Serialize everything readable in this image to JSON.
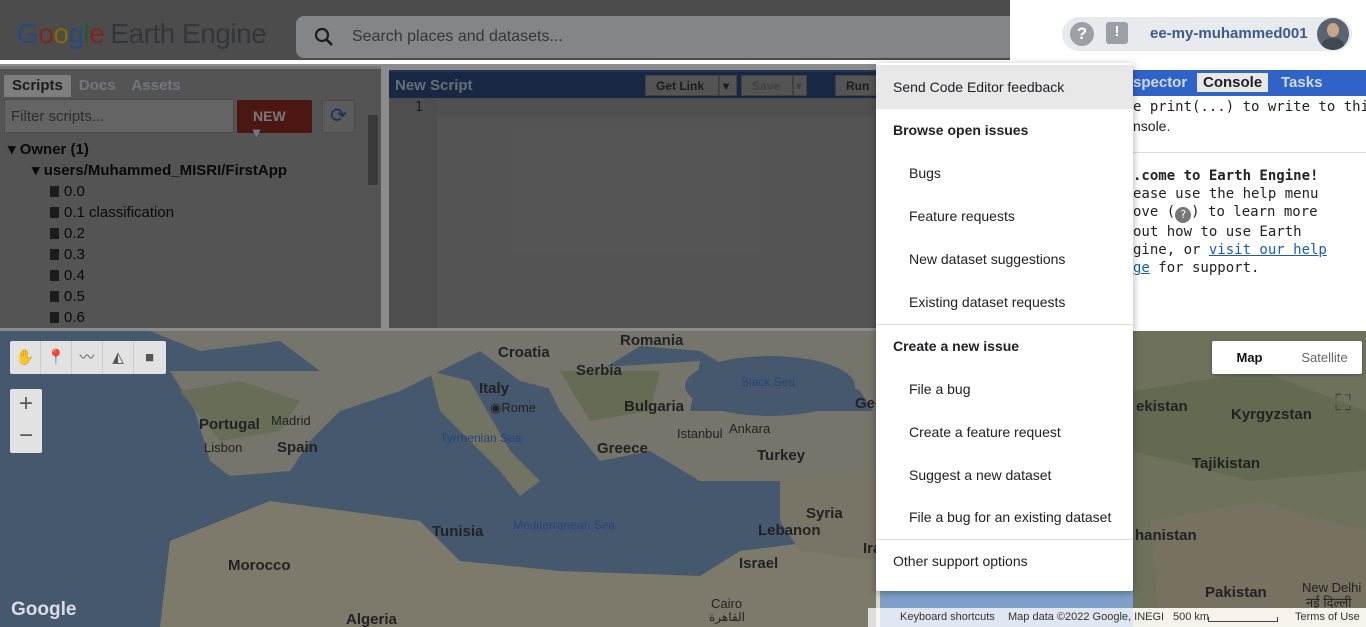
{
  "header": {
    "logo_google": "Google",
    "logo_product": "Earth Engine",
    "search_placeholder": "Search places and datasets...",
    "username": "ee-my-muhammed001",
    "help_glyph": "?",
    "feedback_glyph": "!"
  },
  "left_panel": {
    "tabs": [
      "Scripts",
      "Docs",
      "Assets"
    ],
    "filter_placeholder": "Filter scripts...",
    "new_button": "NEW",
    "tree": {
      "owner": "Owner (1)",
      "folder": "users/Muhammed_MISRI/FirstApp",
      "files": [
        "0.0",
        "0.1 classification",
        "0.2",
        "0.3",
        "0.4",
        "0.5",
        "0.6"
      ]
    }
  },
  "editor": {
    "title": "New Script",
    "get_link": "Get Link",
    "save": "Save",
    "run": "Run",
    "line_number": "1"
  },
  "right_panel": {
    "tabs": [
      "spector",
      "Console",
      "Tasks"
    ],
    "console_line1": "e print(...) to write to this",
    "console_line2": "nsole.",
    "welcome": ".come to Earth Engine!",
    "w2": "ease use the help menu",
    "w3a": "ove (",
    "w3b": ") to learn more",
    "w4": "out how to use Earth",
    "w5a": "gine, or ",
    "w5link": "visit our help",
    "w6link": "ge",
    "w6b": " for support."
  },
  "menu": {
    "items": [
      {
        "label": "Send Code Editor feedback",
        "kind": "plain"
      },
      {
        "label": "Browse open issues",
        "kind": "head"
      },
      {
        "label": "Bugs",
        "kind": "sub"
      },
      {
        "label": "Feature requests",
        "kind": "sub"
      },
      {
        "label": "New dataset suggestions",
        "kind": "sub"
      },
      {
        "label": "Existing dataset requests",
        "kind": "sub"
      },
      {
        "label": "Create a new issue",
        "kind": "head"
      },
      {
        "label": "File a bug",
        "kind": "sub"
      },
      {
        "label": "Create a feature request",
        "kind": "sub"
      },
      {
        "label": "Suggest a new dataset",
        "kind": "sub"
      },
      {
        "label": "File a bug for an existing dataset",
        "kind": "sub"
      },
      {
        "label": "Other support options",
        "kind": "plain"
      }
    ]
  },
  "map": {
    "map_type": [
      "Map",
      "Satellite"
    ],
    "zoom_in": "+",
    "zoom_out": "−",
    "watermark": "Google",
    "attribution": {
      "shortcuts": "Keyboard shortcuts",
      "data": "Map data ©2022 Google, INEGI",
      "scale": "500 km",
      "terms": "Terms of Use"
    },
    "labels": {
      "croatia": "Croatia",
      "romania": "Romania",
      "serbia": "Serbia",
      "italy": "Italy",
      "rome": "Rome",
      "bulgaria": "Bulgaria",
      "portugal": "Portugal",
      "madrid": "Madrid",
      "spain": "Spain",
      "lisbon": "Lisbon",
      "istanbul": "Istanbul",
      "ankara": "Ankara",
      "greece": "Greece",
      "turkey": "Turkey",
      "tunisia": "Tunisia",
      "syria": "Syria",
      "lebanon": "Lebanon",
      "morocco": "Morocco",
      "israel": "Israel",
      "algeria": "Algeria",
      "cairo": "Cairo",
      "cairo_ar": "القاهرة",
      "ira": "Ira",
      "geo": "Geo",
      "kistan": "ekistan",
      "kyrgyzstan": "Kyrgyzstan",
      "tajikistan": "Tajikistan",
      "hanistan": "hanistan",
      "pakistan": "Pakistan",
      "newdelhi": "New Delhi",
      "newdelhi_hi": "नई दिल्ली",
      "black_sea": "Black Sea",
      "tyrrhenian": "Tyrrhenian Sea",
      "med_sea": "Mediterranean Sea"
    }
  },
  "colors": {
    "accent_blue": "#2f63c8",
    "new_red": "#d23f31",
    "sea": "#7fa1c9",
    "land": "#d9d7c8"
  }
}
